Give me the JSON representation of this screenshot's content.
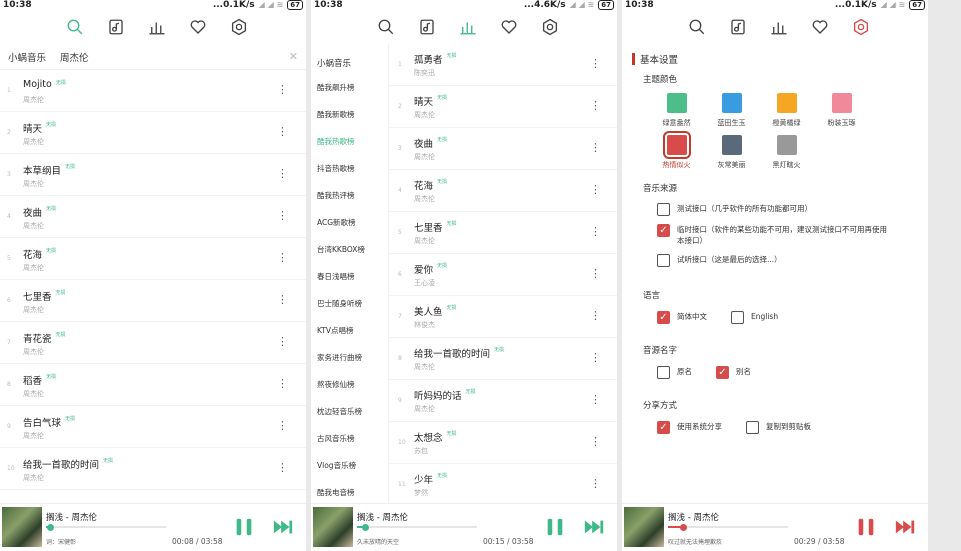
{
  "colors": {
    "accent_green": "#3fb88a",
    "accent_red": "#d84b4b"
  },
  "screens": [
    {
      "status": {
        "time": "10:38",
        "speed": "...0.1K/s",
        "battery": "67"
      },
      "nav_active": "search",
      "search": {
        "source": "小蜗音乐",
        "keyword": "周杰伦",
        "close": "✕"
      },
      "songs": [
        {
          "idx": "1",
          "title": "Mojito",
          "badge": "无损",
          "artist": "周杰伦"
        },
        {
          "idx": "2",
          "title": "晴天",
          "badge": "无损",
          "artist": "周杰伦"
        },
        {
          "idx": "3",
          "title": "本草纲目",
          "badge": "无损",
          "artist": "周杰伦"
        },
        {
          "idx": "4",
          "title": "夜曲",
          "badge": "无损",
          "artist": "周杰伦"
        },
        {
          "idx": "5",
          "title": "花海",
          "badge": "无损",
          "artist": "周杰伦"
        },
        {
          "idx": "6",
          "title": "七里香",
          "badge": "无损",
          "artist": "周杰伦"
        },
        {
          "idx": "7",
          "title": "青花瓷",
          "badge": "无损",
          "artist": "周杰伦"
        },
        {
          "idx": "8",
          "title": "稻香",
          "badge": "无损",
          "artist": "周杰伦"
        },
        {
          "idx": "9",
          "title": "告白气球",
          "badge": "无损",
          "artist": "周杰伦"
        },
        {
          "idx": "10",
          "title": "给我一首歌的时间",
          "badge": "无损",
          "artist": "周杰伦"
        }
      ],
      "player": {
        "title": "搁浅 - 周杰伦",
        "lyric": "词：宋健彰",
        "time": "00:08 / 03:58",
        "progress": 0.034,
        "color": "#3fb88a"
      }
    },
    {
      "status": {
        "time": "10:38",
        "speed": "...4.6K/s",
        "battery": "67"
      },
      "nav_active": "chart",
      "chart_lists": [
        "小蜗音乐",
        "酷我飙升榜",
        "酷我新歌榜",
        "酷我热歌榜",
        "抖音热歌榜",
        "酷我热评榜",
        "ACG新歌榜",
        "台湾KKBOX榜",
        "春日浅唱榜",
        "巴士随身听榜",
        "KTV点唱榜",
        "家务进行曲榜",
        "熬夜修仙榜",
        "枕边轻音乐榜",
        "古风音乐榜",
        "Vlog音乐榜",
        "酷我电音榜"
      ],
      "chart_active_index": 3,
      "songs": [
        {
          "idx": "1",
          "title": "孤勇者",
          "badge": "无损",
          "artist": "陈奕迅"
        },
        {
          "idx": "2",
          "title": "晴天",
          "badge": "无损",
          "artist": "周杰伦"
        },
        {
          "idx": "3",
          "title": "夜曲",
          "badge": "无损",
          "artist": "周杰伦"
        },
        {
          "idx": "4",
          "title": "花海",
          "badge": "无损",
          "artist": "周杰伦"
        },
        {
          "idx": "5",
          "title": "七里香",
          "badge": "无损",
          "artist": "周杰伦"
        },
        {
          "idx": "6",
          "title": "爱你",
          "badge": "无损",
          "artist": "王心凌"
        },
        {
          "idx": "7",
          "title": "美人鱼",
          "badge": "无损",
          "artist": "林俊杰"
        },
        {
          "idx": "8",
          "title": "给我一首歌的时间",
          "badge": "无损",
          "artist": "周杰伦"
        },
        {
          "idx": "9",
          "title": "听妈妈的话",
          "badge": "无损",
          "artist": "周杰伦"
        },
        {
          "idx": "10",
          "title": "太想念",
          "badge": "无损",
          "artist": "苏包"
        },
        {
          "idx": "11",
          "title": "少年",
          "badge": "无损",
          "artist": "梦然"
        }
      ],
      "player": {
        "title": "搁浅 - 周杰伦",
        "lyric": "久未放晴的天空",
        "time": "00:15 / 03:58",
        "progress": 0.063,
        "color": "#3fb88a"
      }
    },
    {
      "status": {
        "time": "10:38",
        "speed": "...0.1K/s",
        "battery": "67"
      },
      "nav_active": "settings",
      "section_title": "基本设置",
      "theme_label": "主题颜色",
      "themes": [
        {
          "name": "绿意盎然",
          "color": "#4dbd8a",
          "selected": false
        },
        {
          "name": "蓝田生玉",
          "color": "#3a9ce0",
          "selected": false
        },
        {
          "name": "橙黄橘绿",
          "color": "#f5a623",
          "selected": false
        },
        {
          "name": "粉装玉琢",
          "color": "#f08a9a",
          "selected": false
        },
        {
          "name": "热情似火",
          "color": "#d84b4b",
          "selected": true
        },
        {
          "name": "灰常美丽",
          "color": "#5a6a7a",
          "selected": false
        },
        {
          "name": "黑灯瞎火",
          "color": "#999999",
          "selected": false
        }
      ],
      "music_source_label": "音乐来源",
      "music_sources": [
        {
          "label": "测试接口（几乎软件的所有功能都可用）",
          "checked": false
        },
        {
          "label": "临时接口（软件的某些功能不可用，建议测试接口不可用再使用本接口）",
          "checked": true
        },
        {
          "label": "试听接口（这是最后的选择...）",
          "checked": false
        }
      ],
      "language_label": "语言",
      "languages": [
        {
          "label": "简体中文",
          "checked": true
        },
        {
          "label": "English",
          "checked": false
        }
      ],
      "source_name_label": "音源名字",
      "source_names": [
        {
          "label": "原名",
          "checked": false
        },
        {
          "label": "别名",
          "checked": true
        }
      ],
      "share_label": "分享方式",
      "share_methods": [
        {
          "label": "使用系统分享",
          "checked": true
        },
        {
          "label": "复制到剪贴板",
          "checked": false
        }
      ],
      "player": {
        "title": "搁浅 - 周杰伦",
        "lyric": "叹过就无法掩埋歉疚",
        "time": "00:29 / 03:58",
        "progress": 0.122,
        "color": "#d84b4b"
      }
    }
  ],
  "nav_icons": [
    "search-icon",
    "music-list-icon",
    "chart-icon",
    "heart-icon",
    "settings-icon"
  ]
}
